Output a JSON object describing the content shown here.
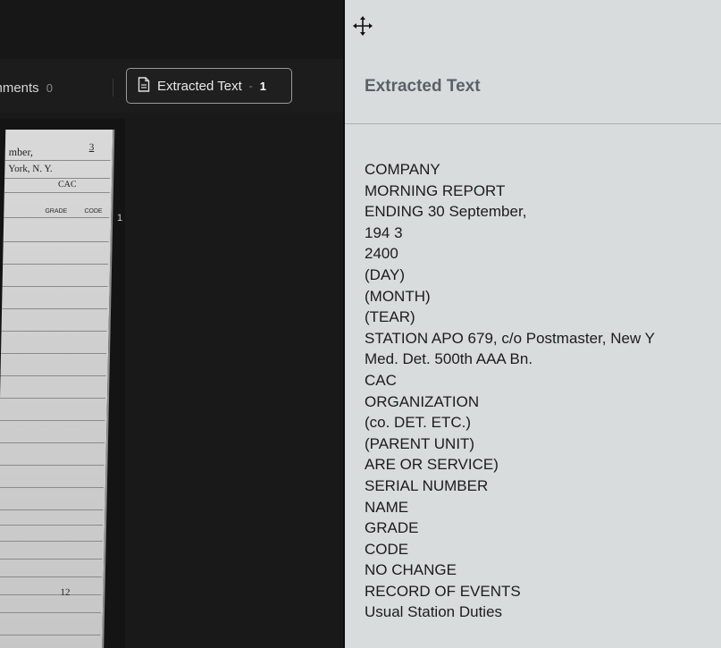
{
  "toolbar": {
    "comments_label": "omments",
    "comments_count": "0",
    "extracted_label": "Extracted Text",
    "extracted_count": "1"
  },
  "document_snippet": {
    "line1": "mber,",
    "year_digit": "3",
    "line2": "York, N. Y.",
    "line3": "CAC",
    "grade_header": "GRADE",
    "code_header": "CODE",
    "margin_number": "1",
    "lower_value": "12"
  },
  "panel": {
    "title": "Extracted Text",
    "lines": [
      "COMPANY",
      "MORNING REPORT",
      "ENDING 30 September,",
      "194 3",
      "2400",
      "(DAY)",
      "(MONTH)",
      "(TEAR)",
      "STATION APO 679, c/o Postmaster, New Y",
      "Med. Det. 500th AAA Bn.",
      "CAC",
      "ORGANIZATION",
      "(co. DET. ETC.)",
      "(PARENT UNIT)",
      "ARE OR SERVICE)",
      "SERIAL NUMBER",
      "NAME",
      "GRADE",
      "CODE",
      "NO CHANGE",
      "RECORD OF EVENTS",
      "Usual Station Duties"
    ]
  },
  "icons": {
    "move": "move-arrows-icon",
    "document": "document-icon"
  }
}
